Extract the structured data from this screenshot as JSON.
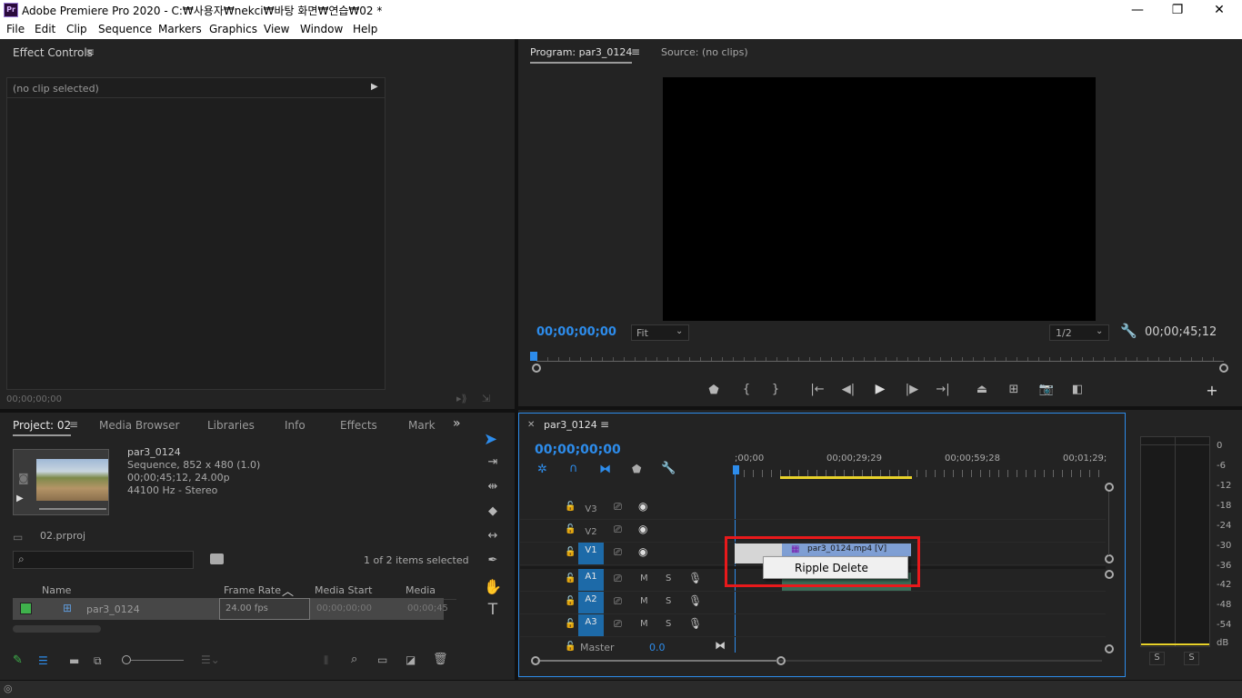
{
  "window": {
    "title": "Adobe Premiere Pro 2020 - C:₩사용자₩nekci₩바탕 화면₩연습₩02 *",
    "app_icon": "Pr",
    "minimize": "—",
    "maximize": "❐",
    "close": "✕"
  },
  "menu": [
    "File",
    "Edit",
    "Clip",
    "Sequence",
    "Markers",
    "Graphics",
    "View",
    "Window",
    "Help"
  ],
  "effect_controls": {
    "title": "Effect Controls",
    "no_clip": "(no clip selected)",
    "timecode": "00;00;00;00"
  },
  "program": {
    "tab": "Program: par3_0124",
    "source_tab": "Source: (no clips)",
    "timecode": "00;00;00;00",
    "fit": "Fit",
    "resolution": "1/2",
    "duration": "00;00;45;12"
  },
  "project": {
    "tabs": [
      "Project: 02",
      "Media Browser",
      "Libraries",
      "Info",
      "Effects",
      "Mark"
    ],
    "clip_name": "par3_0124",
    "clip_info": [
      "Sequence, 852 x 480 (1.0)",
      "00;00;45;12, 24.00p",
      "44100 Hz - Stereo"
    ],
    "project_file": "02.prproj",
    "items_selected": "1 of 2 items selected",
    "columns": [
      "Name",
      "Frame Rate",
      "Media Start",
      "Media End"
    ],
    "row": {
      "name": "par3_0124",
      "frame_rate": "24.00 fps",
      "media_start": "00;00;00;00",
      "media_end": "00;00;45"
    }
  },
  "timeline": {
    "tab": "par3_0124",
    "timecode": "00;00;00;00",
    "ruler": [
      ";00;00",
      "00;00;29;29",
      "00;00;59;28",
      "00;01;29;"
    ],
    "video_tracks": [
      "V3",
      "V2",
      "V1"
    ],
    "audio_tracks": [
      "A1",
      "A2",
      "A3"
    ],
    "master": "Master",
    "master_value": "0.0",
    "mute": "M",
    "solo": "S",
    "clip_label": "par3_0124.mp4 [V]",
    "context_menu": [
      "Ripple Delete"
    ]
  },
  "meter": {
    "scale": [
      "0",
      "-6",
      "-12",
      "-18",
      "-24",
      "-30",
      "-36",
      "-42",
      "-48",
      "-54",
      "dB"
    ],
    "solo": [
      "S",
      "S"
    ]
  },
  "colors": {
    "accent": "#2d8ceb",
    "panel_bg": "#232323",
    "highlight_box": "#e8191b",
    "work_area": "#e8d22a"
  }
}
